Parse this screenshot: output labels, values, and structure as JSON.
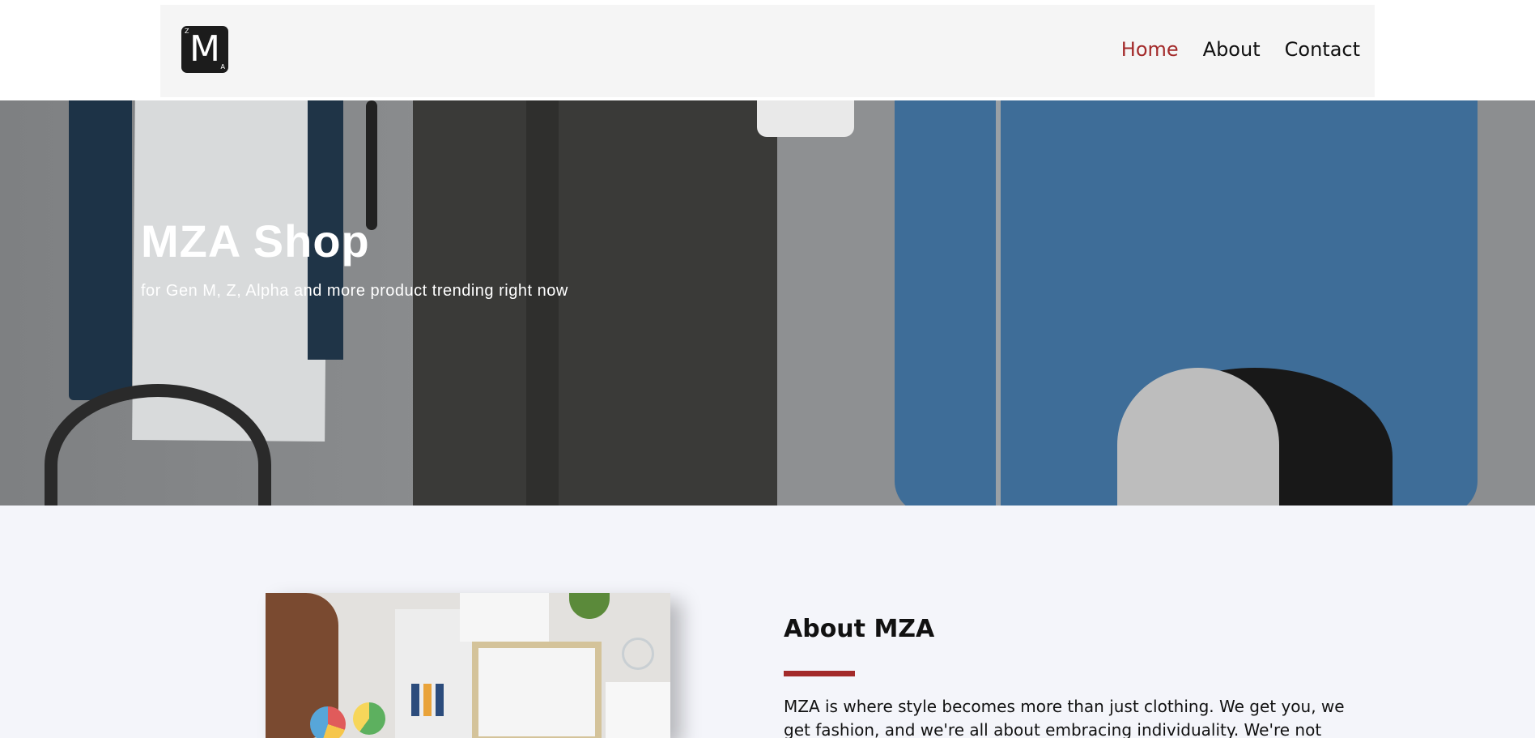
{
  "header": {
    "logo": {
      "main": "M",
      "top_left": "Z",
      "bottom_right": "A"
    },
    "nav": [
      {
        "label": "Home",
        "active": true
      },
      {
        "label": "About",
        "active": false
      },
      {
        "label": "Contact",
        "active": false
      }
    ]
  },
  "hero": {
    "title": "MZA Shop",
    "subtitle": "for Gen M, Z, Alpha and more product trending right now"
  },
  "about": {
    "title": "About MZA",
    "text": "MZA is where style becomes more than just clothing. We get you, we get fashion, and we're all about embracing individuality. We're not"
  },
  "colors": {
    "accent": "#a32a2a",
    "page_bg": "#f4f5fa",
    "header_bg": "#f5f5f5"
  }
}
